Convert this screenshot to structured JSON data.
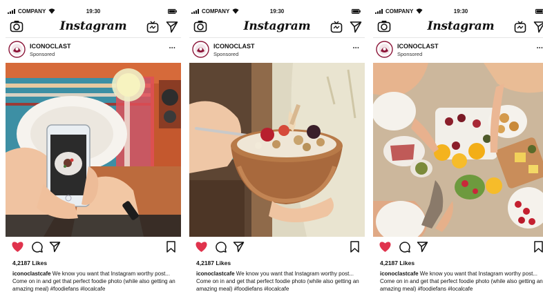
{
  "status": {
    "carrier": "COMPANY",
    "time": "19:30"
  },
  "app": {
    "title": "Instagram"
  },
  "posts": [
    {
      "username": "ICONOCLAST",
      "sponsored": "Sponsored",
      "more": "···",
      "likes": "4,2187 Likes",
      "caption_user": "iconoclastcafe",
      "caption_text": " We know you want that Instagram worthy post... Come on in and get that perfect foodie photo (while also getting an amazing meal) #foodiefans #localcafe",
      "photo": "hands-phone-photographing-plate"
    },
    {
      "username": "ICONOCLAST",
      "sponsored": "Sponsored",
      "more": "···",
      "likes": "4,2187 Likes",
      "caption_user": "iconoclastcafe",
      "caption_text": " We know you want that Instagram worthy post... Come on in and get that perfect foodie photo (while also getting an amazing meal) #foodiefans #localcafe",
      "photo": "hand-spoon-bowl-fruit"
    },
    {
      "username": "ICONOCLAST",
      "sponsored": "Sponsored",
      "more": "···",
      "likes": "4,2187 Likes",
      "caption_user": "iconoclastcafe",
      "caption_text": " We know you want that Instagram worthy post... Come on in and get that perfect foodie photo (while also getting an amazing meal) #foodiefans #localcafe",
      "photo": "table-toast-orange-juice"
    }
  ],
  "colors": {
    "like_red": "#e0334d",
    "brand_ring": "#8b1538"
  },
  "icons": [
    "signal-icon",
    "wifi-icon",
    "battery-icon",
    "camera-icon",
    "igtv-icon",
    "direct-send-icon",
    "heart-icon",
    "comment-icon",
    "share-icon",
    "bookmark-icon"
  ]
}
